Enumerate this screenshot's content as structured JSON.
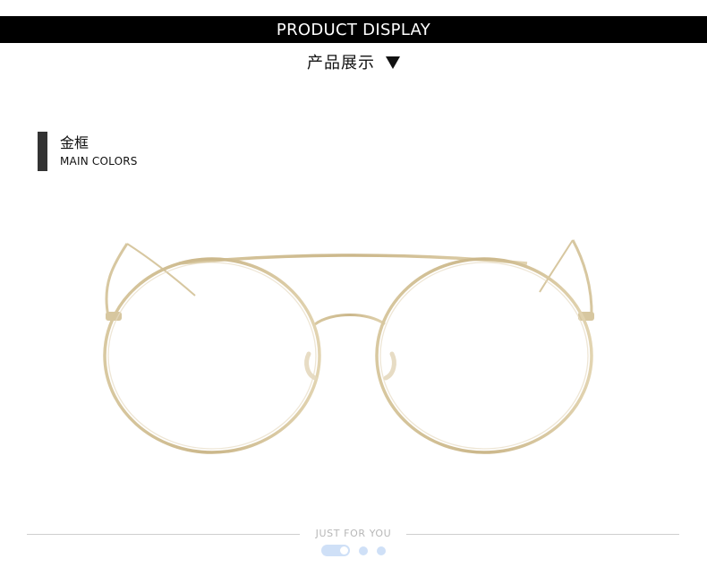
{
  "header": {
    "title": "PRODUCT DISPLAY",
    "subtitle": "产品展示"
  },
  "section": {
    "title_cn": "金框",
    "title_en": "MAIN COLORS"
  },
  "product": {
    "icon": "glasses-image",
    "frame_color": "#d6c6a0"
  },
  "footer": {
    "text": "JUST FOR YOU",
    "pager_active_index": 0,
    "pager_count": 3
  },
  "colors": {
    "top_bar": "#000000",
    "accent": "#333333",
    "pager": "#cfe0f7"
  }
}
